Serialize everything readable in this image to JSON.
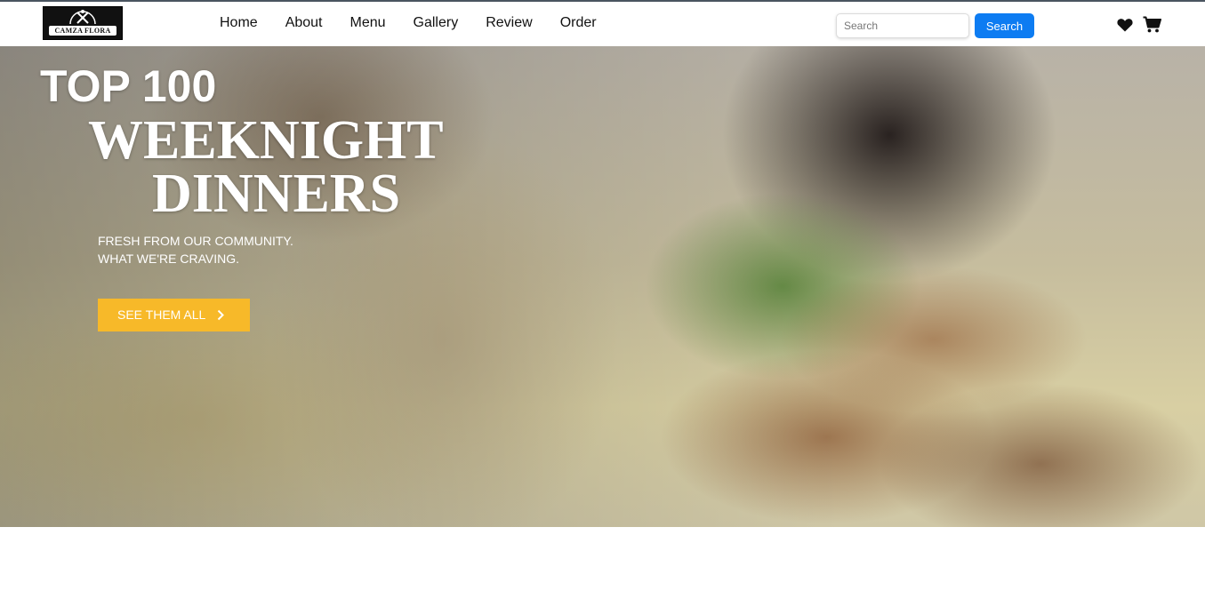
{
  "logo": {
    "text": "CAMZA FLORA"
  },
  "nav": {
    "links": [
      "Home",
      "About",
      "Menu",
      "Gallery",
      "Review",
      "Order"
    ]
  },
  "search": {
    "placeholder": "Search",
    "value": "",
    "button_label": "Search"
  },
  "icons": {
    "favorites": "heart-icon",
    "cart": "cart-icon"
  },
  "hero": {
    "title_line1": "TOP 100",
    "title_line2": "WEEKNIGHT",
    "title_line3": "DINNERS",
    "subtitle_line1": "FRESH FROM OUR COMMUNITY.",
    "subtitle_line2": "WHAT WE'RE CRAVING.",
    "cta_label": "SEE THEM ALL"
  },
  "colors": {
    "primary": "#0d7cf2",
    "accent": "#f7b929",
    "nav_text": "#111111"
  }
}
